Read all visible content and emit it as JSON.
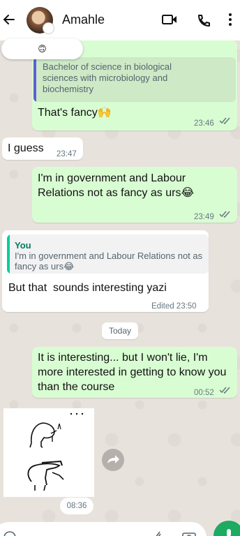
{
  "header": {
    "contact_name": "Amahle",
    "icons": [
      "back-arrow-icon",
      "video-call-icon",
      "voice-call-icon",
      "more-options-icon"
    ]
  },
  "reaction": {
    "emoji": "🙃"
  },
  "messages": [
    {
      "id": "m1",
      "direction": "outgoing",
      "quoted_text": "Bachelor of science in biological sciences with microbiology and biochemistry",
      "text": "That's fancy🙌",
      "time": "23:46"
    },
    {
      "id": "m2",
      "direction": "incoming",
      "text": "I guess",
      "time": "23:47"
    },
    {
      "id": "m3",
      "direction": "outgoing",
      "text": "I'm in government and Labour Relations not as fancy as urs😂",
      "time": "23:49"
    },
    {
      "id": "m4",
      "direction": "incoming",
      "quote_author": "You",
      "quoted_text": "I'm in government and Labour Relations not as fancy as urs😂",
      "text": "But that  sounds interesting yazi",
      "edited_time": "Edited 23:50"
    },
    {
      "id": "m5",
      "direction": "outgoing",
      "text": "It is interesting... but I won't lie, I'm more interested in getting to know you than the course",
      "time": "00:52"
    },
    {
      "id": "m6",
      "direction": "incoming",
      "type": "sticker",
      "time": "08:36"
    }
  ],
  "date_divider": "Today",
  "colors": {
    "outgoing_bubble": "#d9fdd3",
    "incoming_bubble": "#ffffff",
    "read_ticks": "#667781",
    "accent_green": "#1daa61"
  }
}
